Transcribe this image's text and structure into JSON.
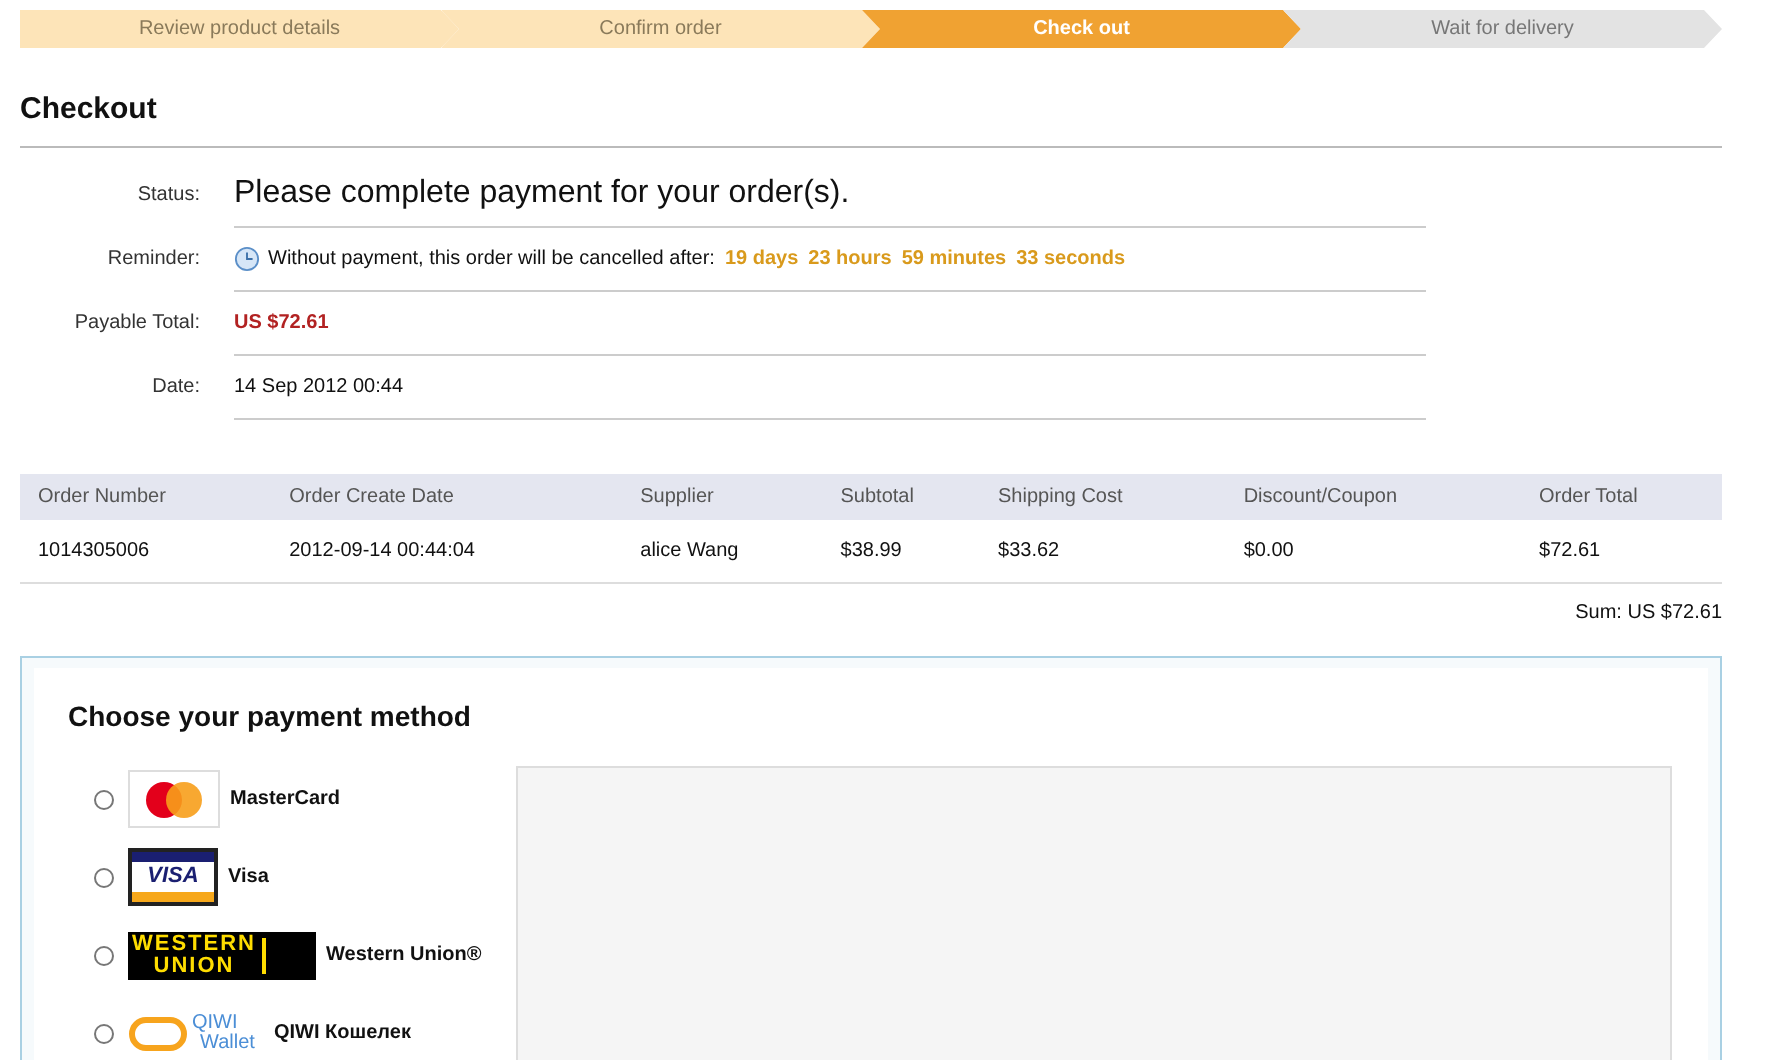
{
  "steps": [
    {
      "label": "Review product details",
      "done": true,
      "selected": false
    },
    {
      "label": "Confirm order",
      "done": true,
      "selected": false
    },
    {
      "label": "Check out",
      "done": false,
      "selected": true
    },
    {
      "label": "Wait for delivery",
      "done": false,
      "selected": false
    }
  ],
  "title": "Checkout",
  "info": [
    {
      "label": "Status:",
      "kind": "status",
      "value": "Please complete payment for your order(s)."
    },
    {
      "label": "Reminder:",
      "kind": "reminder",
      "value": "Without payment, this order will be cancelled after:",
      "countdown": [
        "19 days",
        "23 hours",
        "59 minutes",
        "33 seconds"
      ]
    },
    {
      "label": "Payable Total:",
      "kind": "total",
      "value": "US $72.61"
    },
    {
      "label": "Date:",
      "kind": "plain",
      "value": "14 Sep 2012 00:44"
    }
  ],
  "table": {
    "columns": [
      "Order Number",
      "Order Create Date",
      "Supplier",
      "Subtotal",
      "Shipping Cost",
      "Discount/Coupon",
      "Order Total"
    ],
    "rows": [
      [
        "1014305006",
        "2012-09-14 00:44:04",
        "alice Wang",
        "$38.99",
        "$33.62",
        "$0.00",
        "$72.61"
      ]
    ],
    "sum": "Sum: US $72.61"
  },
  "payment": {
    "heading": "Choose your payment method",
    "methods": [
      {
        "kind": "mastercard",
        "label": "MasterCard",
        "selected": false
      },
      {
        "kind": "visa",
        "label": "Visa",
        "selected": false,
        "logo_text": [
          "VISA"
        ]
      },
      {
        "kind": "western_union",
        "label": "Western Union®",
        "selected": false,
        "logo_text": [
          "WESTERN",
          "UNION"
        ]
      },
      {
        "kind": "qiwi",
        "label": "QIWI Кошелек",
        "selected": false,
        "logo_text": [
          "QIWI",
          "Wallet"
        ]
      }
    ]
  }
}
